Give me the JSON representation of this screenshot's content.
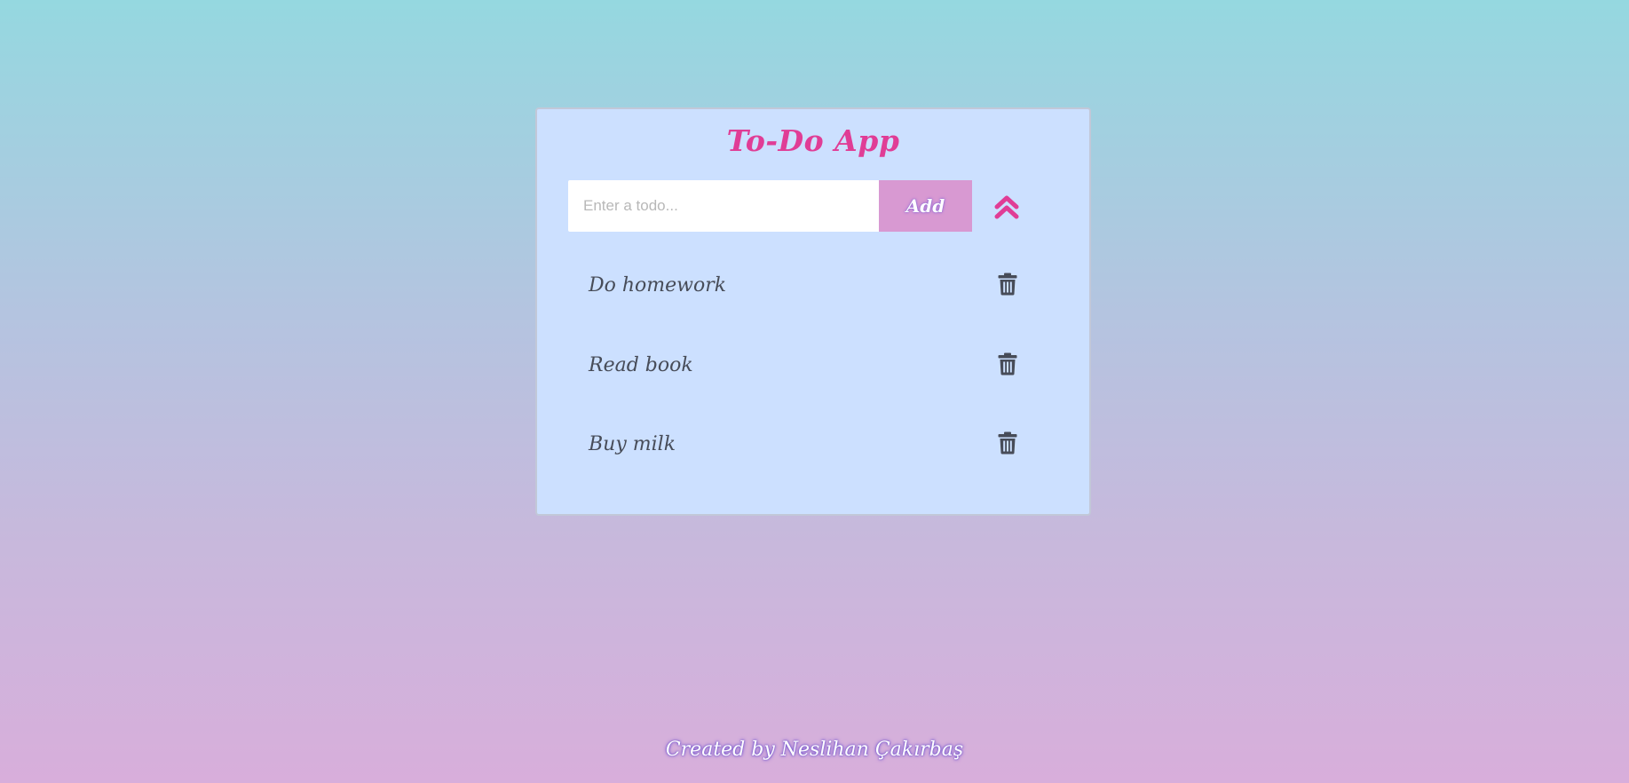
{
  "app": {
    "title": "To-Do App"
  },
  "form": {
    "input_placeholder": "Enter a todo...",
    "input_value": "",
    "add_label": "Add"
  },
  "todos": [
    {
      "text": "Do homework"
    },
    {
      "text": "Read book"
    },
    {
      "text": "Buy milk"
    }
  ],
  "icons": {
    "collapse": "chevron-double-up-icon",
    "delete": "trash-icon"
  },
  "colors": {
    "accent": "#e03d96",
    "add_button": "#d899d2",
    "card_bg": "#cce0ff",
    "icon_dark": "#474c58"
  },
  "footer": {
    "credit": "Created by Neslihan Çakırbaş"
  }
}
